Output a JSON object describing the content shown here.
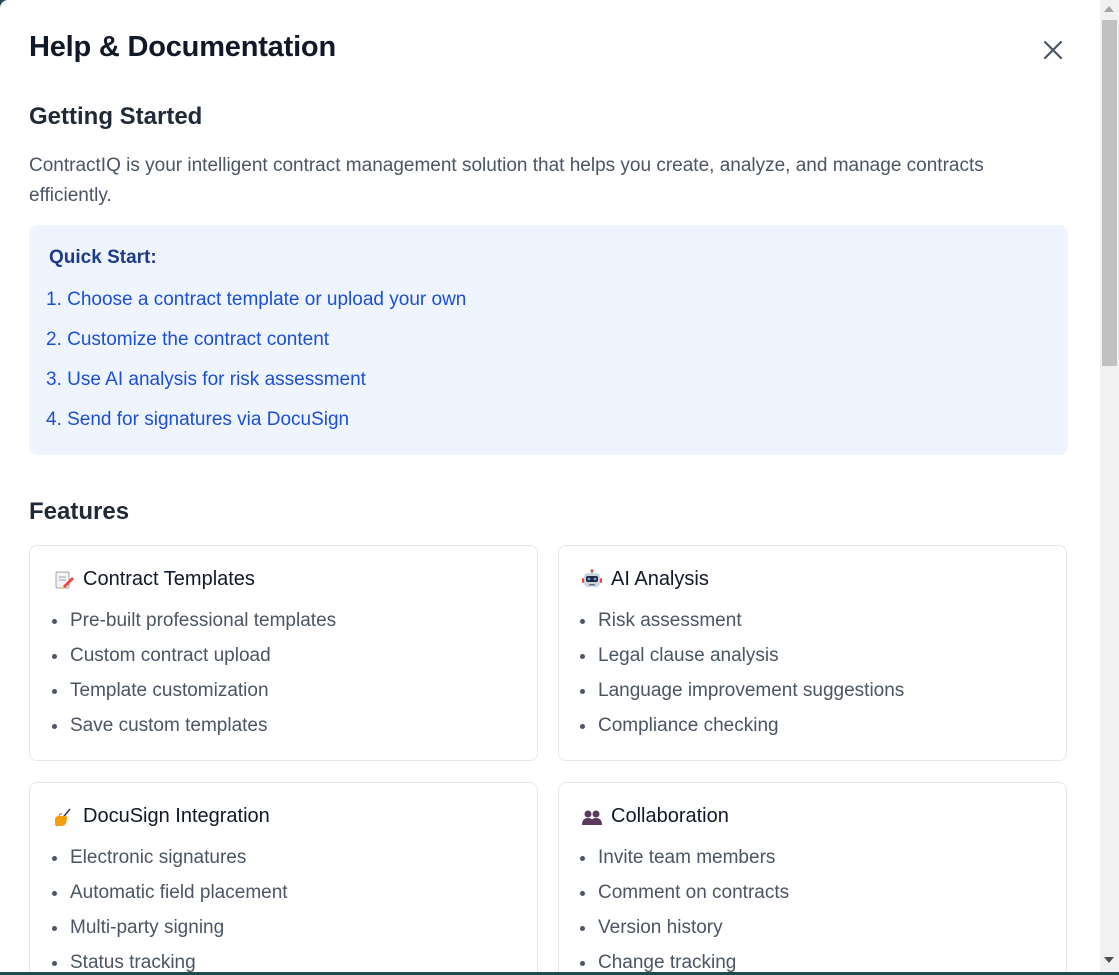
{
  "modal": {
    "title": "Help & Documentation",
    "close_icon": "close-icon"
  },
  "getting_started": {
    "heading": "Getting Started",
    "intro": "ContractIQ is your intelligent contract management solution that helps you create, analyze, and manage contracts efficiently.",
    "quick_start": {
      "title": "Quick Start:",
      "steps": [
        "1. Choose a contract template or upload your own",
        "2. Customize the contract content",
        "3. Use AI analysis for risk assessment",
        "4. Send for signatures via DocuSign"
      ]
    }
  },
  "features": {
    "heading": "Features",
    "cards": [
      {
        "icon": "memo-icon",
        "title": "Contract Templates",
        "items": [
          "Pre-built professional templates",
          "Custom contract upload",
          "Template customization",
          "Save custom templates"
        ]
      },
      {
        "icon": "robot-icon",
        "title": "AI Analysis",
        "items": [
          "Risk assessment",
          "Legal clause analysis",
          "Language improvement suggestions",
          "Compliance checking"
        ]
      },
      {
        "icon": "writing-hand-icon",
        "title": "DocuSign Integration",
        "items": [
          "Electronic signatures",
          "Automatic field placement",
          "Multi-party signing",
          "Status tracking"
        ]
      },
      {
        "icon": "people-icon",
        "title": "Collaboration",
        "items": [
          "Invite team members",
          "Comment on contracts",
          "Version history",
          "Change tracking"
        ]
      }
    ]
  },
  "colors": {
    "accent": "#1d4ed8",
    "quick_start_bg": "#eff5ff",
    "backdrop": "#1f4a4e"
  }
}
